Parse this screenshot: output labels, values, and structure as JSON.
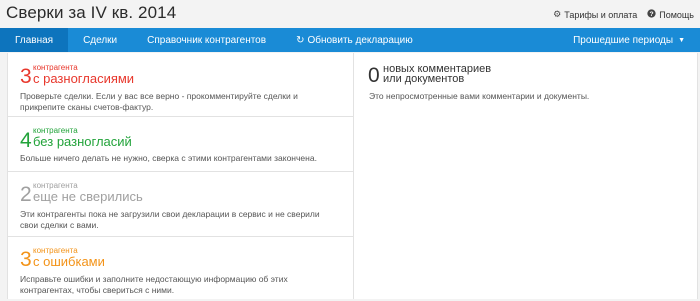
{
  "header": {
    "title": "Сверки за IV кв. 2014",
    "links": [
      {
        "icon": "gear-icon",
        "glyph": "⚙",
        "label": "Тарифы и оплата"
      },
      {
        "icon": "help-icon",
        "glyph": "❓",
        "label": "Помощь"
      }
    ]
  },
  "nav": {
    "tabs": [
      "Главная",
      "Сделки",
      "Справочник контрагентов",
      "Обновить декларацию"
    ],
    "refresh_glyph": "↻",
    "active_index": 0,
    "periods_label": "Прошедшие периоды",
    "periods_caret": "▼"
  },
  "cards": [
    {
      "count": "3",
      "subtitle": "контрагента",
      "title": "с разногласиями",
      "color": "#e8372c",
      "description": "Проверьте сделки. Если у вас все верно - прокомментируйте сделки и прикрепите сканы счетов-фактур."
    },
    {
      "count": "4",
      "subtitle": "контрагента",
      "title": "без разногласий",
      "color": "#22a33a",
      "description": "Больше ничего делать не нужно, сверка с этими контрагентами закончена."
    },
    {
      "count": "2",
      "subtitle": "контрагента",
      "title": "еще не сверились",
      "color": "#a0a0a0",
      "description": "Эти контрагенты пока не загрузили свои декларации в сервис и не сверили свои сделки с вами."
    },
    {
      "count": "3",
      "subtitle": "контрагента",
      "title": "с ошибками",
      "color": "#f39318",
      "description": "Исправьте ошибки и заполните недостающую информацию об этих контрагентах, чтобы свериться с ними."
    }
  ],
  "comments": {
    "count": "0",
    "title_line1": "новых комментариев",
    "title_line2": "или документов",
    "description": "Это непросмотренные вами комментарии и документы."
  }
}
